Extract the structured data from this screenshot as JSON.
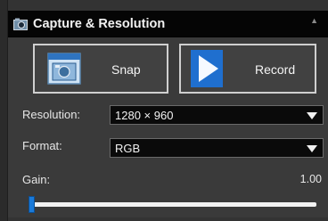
{
  "panel": {
    "title": "Capture & Resolution",
    "icon": "camera-icon",
    "collapse_icon": "collapse-up-icon"
  },
  "buttons": {
    "snap_label": "Snap",
    "snap_icon": "snapshot-window-icon",
    "record_label": "Record",
    "record_icon": "play-triangle-icon"
  },
  "resolution": {
    "label": "Resolution:",
    "value": "1280 × 960"
  },
  "format": {
    "label": "Format:",
    "value": "RGB"
  },
  "gain": {
    "label": "Gain:",
    "value": "1.00",
    "slider_fraction": 0.0
  },
  "colors": {
    "accent": "#1a7ad9",
    "background": "#3a3a3a",
    "header": "#050505"
  }
}
